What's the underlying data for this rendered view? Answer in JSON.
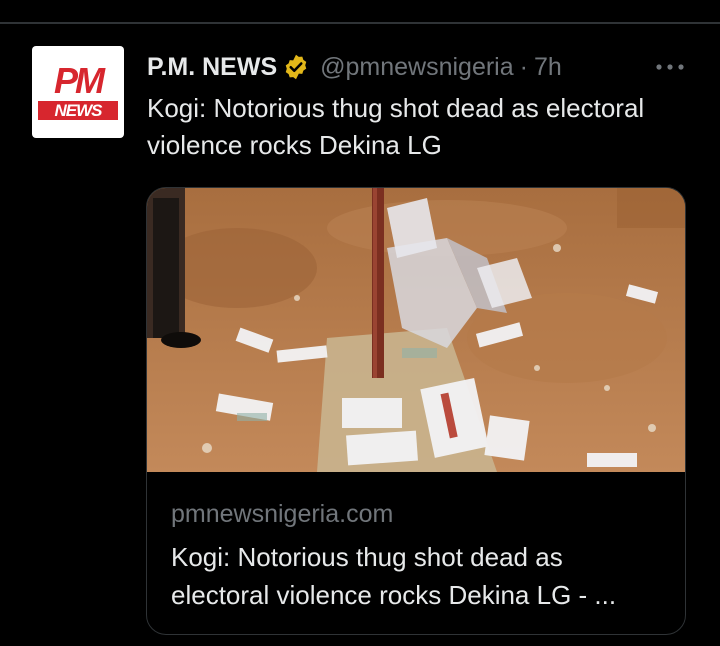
{
  "author": {
    "avatar_top_text": "PM",
    "avatar_bottom_text": "NEWS",
    "name": "P.M. NEWS",
    "handle": "@pmnewsnigeria",
    "separator": "·",
    "time": "7h",
    "verified_icon": "gold-verified-badge"
  },
  "tweet": {
    "text": "Kogi: Notorious thug shot dead as electoral violence rocks Dekina LG"
  },
  "card": {
    "domain": "pmnewsnigeria.com",
    "title": "Kogi: Notorious thug shot dead as electoral violence rocks Dekina LG - ..."
  },
  "colors": {
    "background": "#000000",
    "text_primary": "#e7e9ea",
    "text_secondary": "#71767b",
    "border": "#2f3336",
    "brand_red": "#d7262e",
    "verified_gold": "#e2b719"
  }
}
